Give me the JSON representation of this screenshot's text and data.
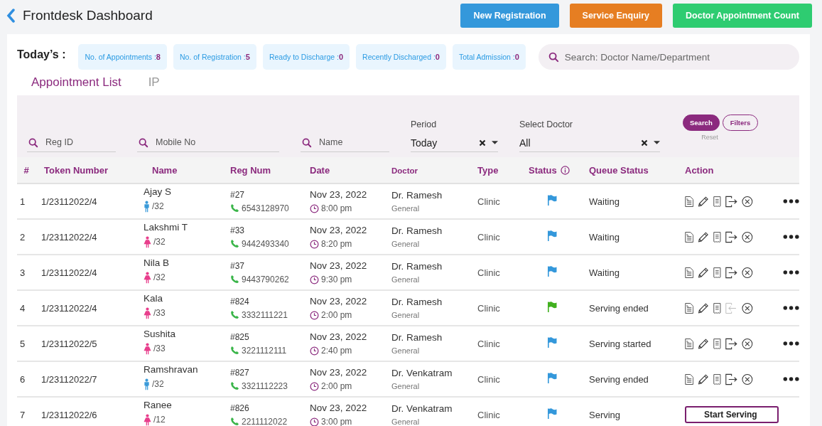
{
  "page_title": "Frontdesk Dashboard",
  "header_buttons": [
    {
      "label": "New Registration",
      "color": "#3498db"
    },
    {
      "label": "Service Enquiry",
      "color": "#e67e22"
    },
    {
      "label": "Doctor Appointment Count",
      "color": "#2ecc71"
    }
  ],
  "todays_label": "Today’s :",
  "stats": [
    {
      "label": "No. of Appointments : ",
      "value": "8"
    },
    {
      "label": "No. of Registration : ",
      "value": "5"
    },
    {
      "label": "Ready to Discharge : ",
      "value": "0"
    },
    {
      "label": "Recently Discharged : ",
      "value": "0"
    },
    {
      "label": "Total Admission : ",
      "value": "0"
    }
  ],
  "search": {
    "placeholder": "Search: Doctor Name/Department"
  },
  "tabs": [
    {
      "label": "Appointment List",
      "selected": true
    },
    {
      "label": "IP",
      "selected": false
    }
  ],
  "filters": {
    "reg_id": {
      "placeholder": "Reg ID"
    },
    "mobile": {
      "placeholder": "Mobile No"
    },
    "name": {
      "placeholder": "Name"
    },
    "period": {
      "label": "Period",
      "value": "Today"
    },
    "doctor": {
      "label": "Select Doctor",
      "value": "All"
    },
    "search_button": "Search",
    "filters_button": "Filters",
    "reset": "Reset"
  },
  "table": {
    "columns": [
      "#",
      "Token Number",
      "Name",
      "Reg Num",
      "Date",
      "Doctor",
      "Type",
      "Status",
      "Queue Status",
      "Action"
    ],
    "rows": [
      {
        "index": "1",
        "token": "1/23112022/4",
        "name": "Ajay S",
        "kind": "male",
        "age": "/32",
        "reg": "#27",
        "phone": "6543128970",
        "date": "Nov 23, 2022",
        "time": "8:00 pm",
        "doctor": "Dr. Ramesh",
        "department": "General",
        "type": "Clinic",
        "color": "#3498db",
        "queue": "Waiting",
        "checkout_enabled": true
      },
      {
        "index": "2",
        "token": "1/23112022/4",
        "name": "Lakshmi T",
        "kind": "female",
        "age": "/32",
        "reg": "#33",
        "phone": "9442493340",
        "date": "Nov 23, 2022",
        "time": "8:20 pm",
        "doctor": "Dr. Ramesh",
        "department": "General",
        "type": "Clinic",
        "color": "#3498db",
        "queue": "Waiting",
        "checkout_enabled": true
      },
      {
        "index": "3",
        "token": "1/23112022/4",
        "name": "Nila B",
        "kind": "female",
        "age": "/32",
        "reg": "#37",
        "phone": "9443790262",
        "date": "Nov 23, 2022",
        "time": "9:30 pm",
        "doctor": "Dr. Ramesh",
        "department": "General",
        "type": "Clinic",
        "color": "#3498db",
        "queue": "Waiting",
        "checkout_enabled": true
      },
      {
        "index": "4",
        "token": "1/23112022/4",
        "name": "Kala",
        "kind": "female",
        "age": "/33",
        "reg": "#824",
        "phone": "3332111221",
        "date": "Nov 23, 2022",
        "time": "2:00 pm",
        "doctor": "Dr. Ramesh",
        "department": "General",
        "type": "Clinic",
        "color": "#41b01f",
        "queue": "Serving ended",
        "checkout_enabled": false
      },
      {
        "index": "5",
        "token": "1/23112022/5",
        "name": "Sushita",
        "kind": "female",
        "age": "/33",
        "reg": "#825",
        "phone": "3221112111",
        "date": "Nov 23, 2022",
        "time": "2:40 pm",
        "doctor": "Dr. Ramesh",
        "department": "General",
        "type": "Clinic",
        "color": "#3498db",
        "queue": "Serving started",
        "checkout_enabled": true
      },
      {
        "index": "6",
        "token": "1/23112022/7",
        "name": "Ramshravan",
        "kind": "male",
        "age": "/32",
        "reg": "#827",
        "phone": "3321112223",
        "date": "Nov 23, 2022",
        "time": "2:00 pm",
        "doctor": "Dr. Venkatram",
        "department": "General",
        "type": "Clinic",
        "color": "#3498db",
        "queue": "Serving ended",
        "checkout_enabled": true
      },
      {
        "index": "7",
        "token": "1/23112022/6",
        "name": "Ranee",
        "kind": "female",
        "age": "/12",
        "reg": "#826",
        "phone": "2211112022",
        "date": "Nov 23, 2022",
        "time": "3:00 pm",
        "doctor": "Dr. Venkatram",
        "department": "General",
        "type": "Clinic",
        "color": "#3498db",
        "queue": "Serving",
        "menu_action": "Start Serving"
      }
    ]
  }
}
